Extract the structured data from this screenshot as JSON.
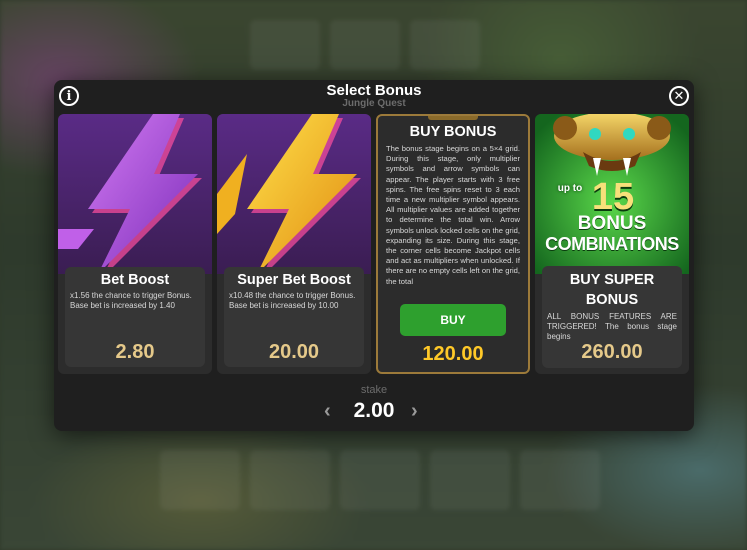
{
  "dialog": {
    "title": "Select Bonus",
    "subtitle": "Jungle Quest"
  },
  "icons": {
    "info": "i",
    "close": "✕",
    "prev": "‹",
    "next": "›"
  },
  "cards": [
    {
      "title": "Bet Boost",
      "description": "x1.56 the chance to trigger Bonus. Base bet is increased by 1.40",
      "price": "2.80",
      "art": "purple-lightning-icon"
    },
    {
      "title": "Super Bet Boost",
      "description": "x10.48 the chance to trigger Bonus. Base bet is increased by 10.00",
      "price": "20.00",
      "art": "gold-lightning-icon"
    },
    {
      "title": "BUY BONUS",
      "description": "The bonus stage begins on a 5×4 grid. During this stage, only multiplier symbols and arrow symbols can appear. The player starts with 3 free spins. The free spins reset to 3 each time a new multiplier symbol appears. All multiplier values are added together to determine the total win. Arrow symbols unlock locked cells on the grid, expanding its size. During this stage, the corner cells become Jackpot cells and act as multipliers when unlocked. If there are no empty cells left on the grid, the total",
      "button": "BUY",
      "price": "120.00"
    },
    {
      "title": "BUY SUPER BONUS",
      "description": "ALL BONUS FEATURES ARE TRIGGERED! The bonus stage begins",
      "price": "260.00",
      "art_text_upto": "up to",
      "art_text_number": "15",
      "art_text_line1": "BONUS",
      "art_text_line2": "COMBINATIONS",
      "art": "golden-monkey-idol-icon"
    }
  ],
  "stake": {
    "label": "stake",
    "value": "2.00"
  },
  "colors": {
    "dialog_bg": "#1f1f1f",
    "card_bg": "#2c2c2c",
    "price": "#e5c98a",
    "price_highlight": "#ffc928",
    "buy_button": "#2ea02e"
  }
}
